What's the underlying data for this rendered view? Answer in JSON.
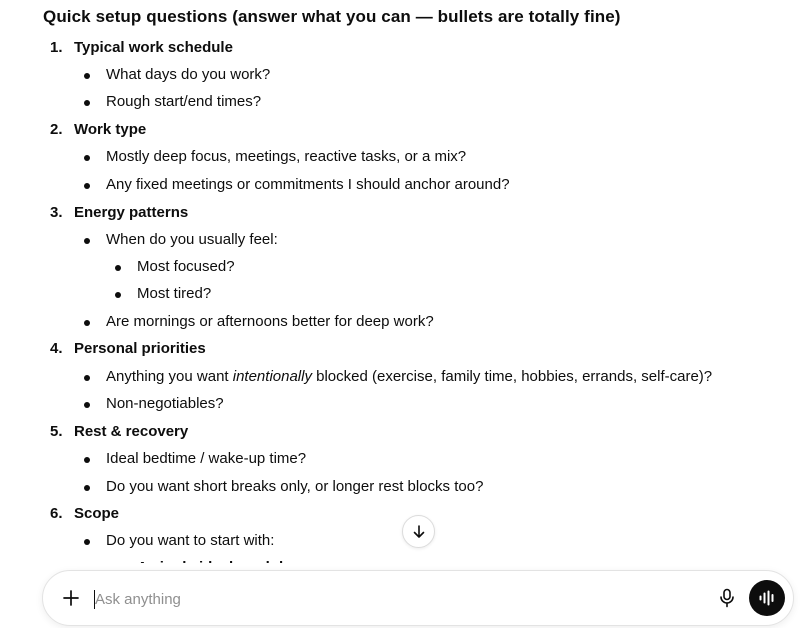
{
  "heading": "Quick setup questions (answer what you can — bullets are totally fine)",
  "sections": [
    {
      "num": "1.",
      "title": "Typical work schedule",
      "b1": "What days do you work?",
      "b2": "Rough start/end times?"
    },
    {
      "num": "2.",
      "title": "Work type",
      "b1": "Mostly deep focus, meetings, reactive tasks, or a mix?",
      "b2": "Any fixed meetings or commitments I should anchor around?"
    },
    {
      "num": "3.",
      "title": "Energy patterns",
      "b1": "When do you usually feel:",
      "s1": "Most focused?",
      "s2": "Most tired?",
      "b2": "Are mornings or afternoons better for deep work?"
    },
    {
      "num": "4.",
      "title": "Personal priorities",
      "b1_pre": "Anything you want ",
      "b1_em": "intentionally",
      "b1_post": " blocked (exercise, family time, hobbies, errands, self-care)?",
      "b2": "Non-negotiables?"
    },
    {
      "num": "5.",
      "title": "Rest & recovery",
      "b1": "Ideal bedtime / wake-up time?",
      "b2": "Do you want short breaks only, or longer rest blocks too?"
    },
    {
      "num": "6.",
      "title": "Scope",
      "b1": "Do you want to start with:",
      "s1": "A single ideal weekday"
    }
  ],
  "composer": {
    "placeholder": "Ask anything",
    "value": ""
  },
  "icons": {
    "add": "plus-icon",
    "mic": "microphone-icon",
    "voice": "voice-mode-icon",
    "scroll": "arrow-down-icon"
  }
}
